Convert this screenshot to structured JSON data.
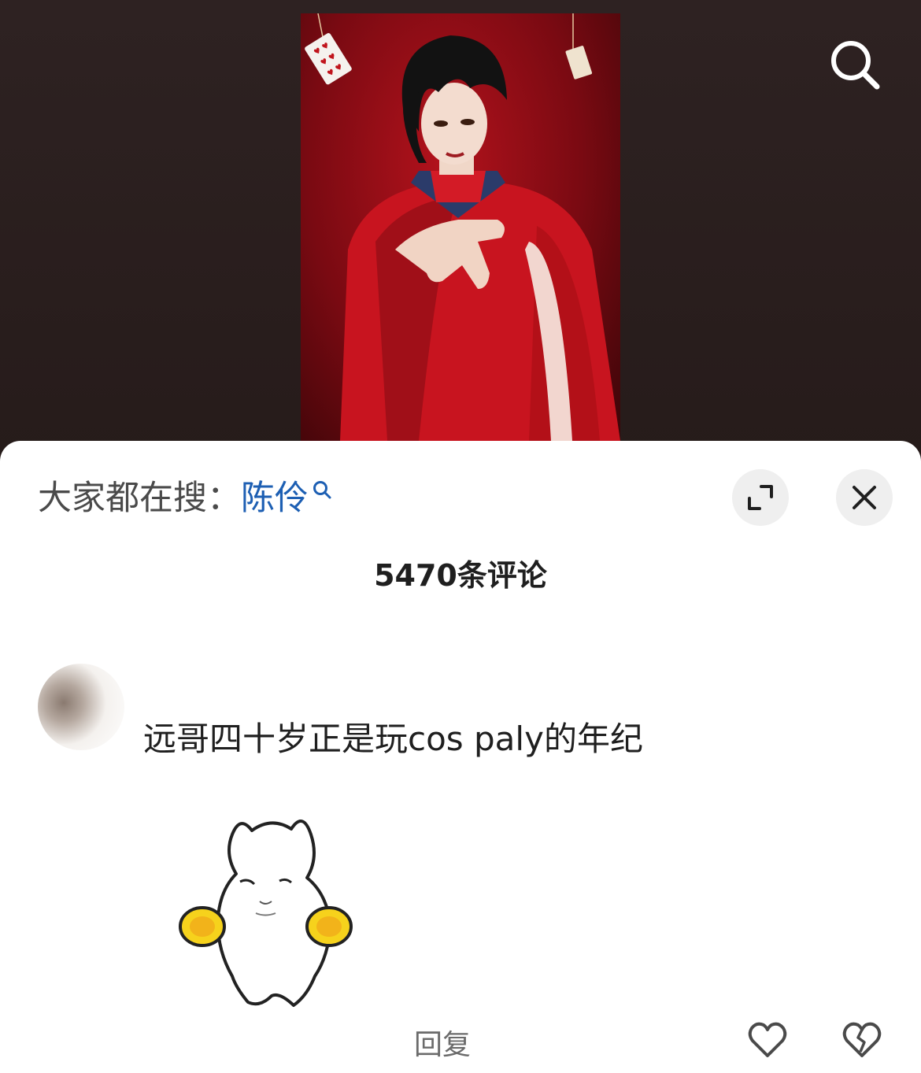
{
  "hot_search": {
    "prefix": "大家都在搜：",
    "term": "陈伶"
  },
  "comments": {
    "count_label": "5470条评论",
    "items": [
      {
        "text": "远哥四十岁正是玩cos paly的年纪",
        "reply_label": "回复"
      }
    ]
  },
  "icons": {
    "top_search": "search-icon",
    "hot_search": "search-icon",
    "expand": "expand-icon",
    "close": "close-icon",
    "like": "heart-icon",
    "dislike": "broken-heart-icon"
  },
  "colors": {
    "link": "#1d5fb3",
    "backdrop": "#2c2222",
    "sheet": "#ffffff"
  }
}
